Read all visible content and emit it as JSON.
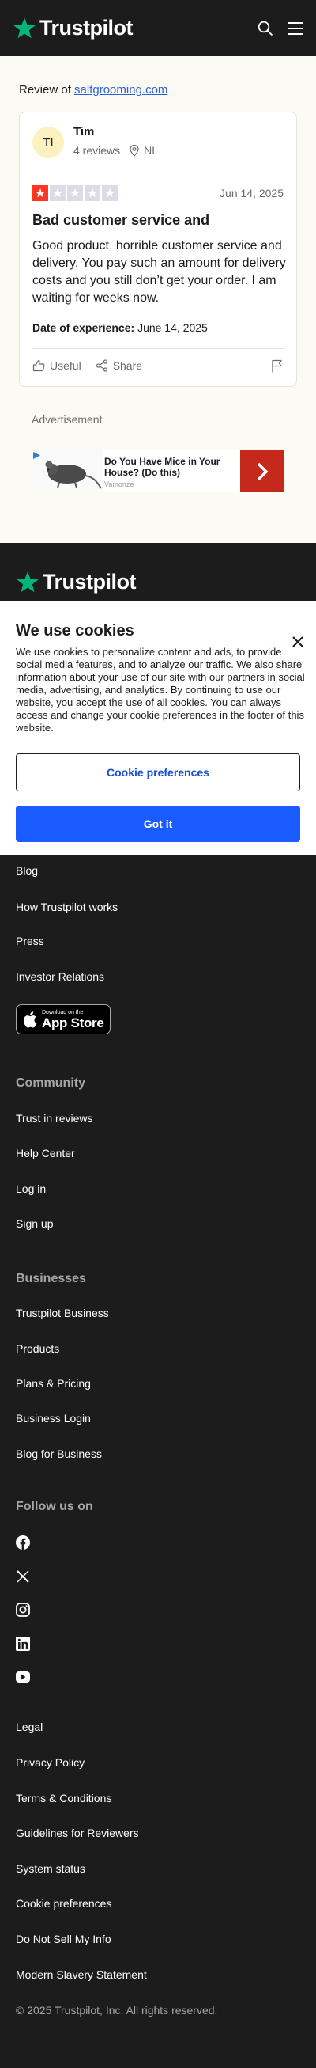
{
  "header": {
    "brand": "Trustpilot",
    "brand_color": "#00b67a",
    "icons": [
      "search-icon",
      "menu-icon"
    ]
  },
  "review_page": {
    "review_of_label": "Review of",
    "company_link": "saltgrooming.com"
  },
  "review": {
    "avatar_initials": "TI",
    "reviewer_name": "Tim",
    "review_count": "4 reviews",
    "country": "NL",
    "rating": 1,
    "max_rating": 5,
    "date": "Jun 14, 2025",
    "title": "Bad customer service and",
    "body": "Good product, horrible customer service and delivery. You pay such an amount for delivery costs and you still don’t get your order. I am waiting for weeks now.",
    "experience_label": "Date of experience:",
    "experience_date": "June 14, 2025",
    "useful_label": "Useful",
    "share_label": "Share"
  },
  "advertisement": {
    "label": "Advertisement",
    "title": "Do You Have Mice in Your House? (Do this)",
    "source": "Vamonze",
    "cta_color": "#c5291c"
  },
  "cookie_banner": {
    "title": "We use cookies",
    "text": "We use cookies to personalize content and ads, to provide social media features, and to analyze our traffic. We also share information about your use of our site with our partners in social media, advertising, and analytics. By continuing to use our website, you accept the use of all cookies. You can always access and change your cookie preferences in the footer of this website.",
    "preferences_button": "Cookie preferences",
    "accept_button": "Got it"
  },
  "footer": {
    "brand": "Trustpilot",
    "about_links": [
      "Blog",
      "How Trustpilot works",
      "Press",
      "Investor Relations"
    ],
    "app_store_small": "Download on the",
    "app_store_big": "App Store",
    "community_heading": "Community",
    "community_links": [
      "Trust in reviews",
      "Help Center",
      "Log in",
      "Sign up"
    ],
    "businesses_heading": "Businesses",
    "business_links": [
      "Trustpilot Business",
      "Products",
      "Plans & Pricing",
      "Business Login",
      "Blog for Business"
    ],
    "follow_heading": "Follow us on",
    "social_icons": [
      "facebook-icon",
      "x-icon",
      "instagram-icon",
      "linkedin-icon",
      "youtube-icon"
    ],
    "legal_links": [
      "Legal",
      "Privacy Policy",
      "Terms & Conditions",
      "Guidelines for Reviewers",
      "System status",
      "Cookie preferences",
      "Do Not Sell My Info",
      "Modern Slavery Statement"
    ],
    "copyright": "© 2025 Trustpilot, Inc. All rights reserved."
  }
}
